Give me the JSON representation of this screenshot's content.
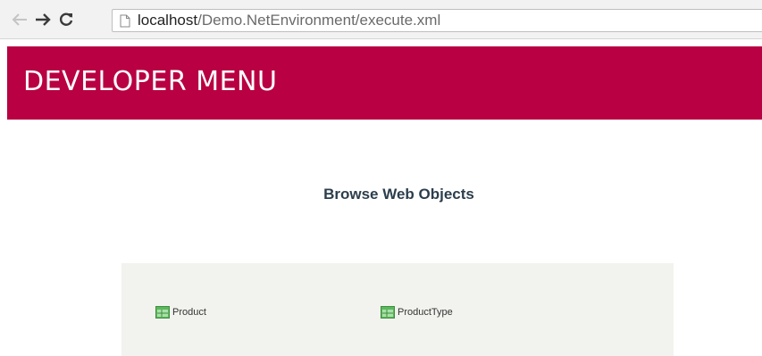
{
  "browser": {
    "url_host": "localhost",
    "url_path": "/Demo.NetEnvironment/execute.xml"
  },
  "header": {
    "title": "DEVELOPER MENU",
    "background_color": "#b80042"
  },
  "main": {
    "title": "Browse Web Objects",
    "objects": [
      {
        "label": "Product",
        "icon": "table-icon"
      },
      {
        "label": "ProductType",
        "icon": "table-icon"
      }
    ]
  }
}
